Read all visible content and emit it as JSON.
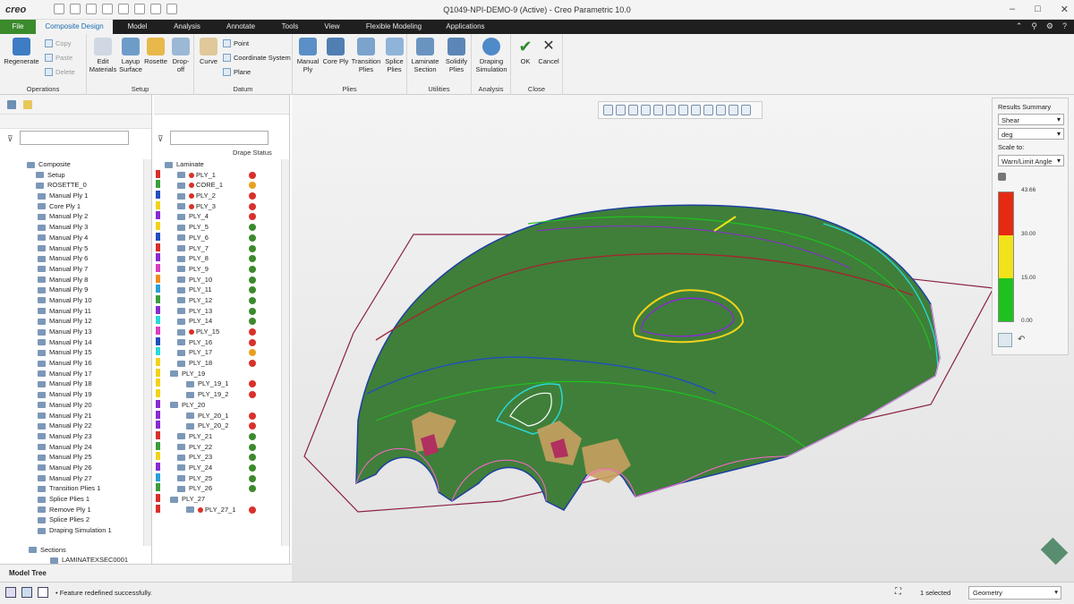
{
  "title_bar": {
    "logo": "creo",
    "window_title": "Q1049-NPI-DEMO-9 (Active) - Creo Parametric 10.0"
  },
  "tabs": [
    "File",
    "Composite Design",
    "Model",
    "Analysis",
    "Annotate",
    "Tools",
    "View",
    "Flexible Modeling",
    "Applications"
  ],
  "ribbon": {
    "operations": {
      "regenerate": "Regenerate",
      "copy": "Copy",
      "paste": "Paste",
      "delete": "Delete",
      "label": "Operations"
    },
    "setup": {
      "edit_materials": "Edit Materials",
      "layup_surface": "Layup Surface",
      "rosette": "Rosette",
      "drop_off": "Drop-off",
      "label": "Setup"
    },
    "datum": {
      "curve": "Curve",
      "point": "Point",
      "coordinate_system": "Coordinate System",
      "plane": "Plane",
      "label": "Datum"
    },
    "plies": {
      "manual_ply": "Manual Ply",
      "core_ply": "Core Ply",
      "transition_plies": "Transition Plies",
      "splice_plies": "Splice Plies",
      "label": "Plies"
    },
    "utilities": {
      "laminate_section": "Laminate Section",
      "solidify_plies": "Solidify Plies",
      "label": "Utilities"
    },
    "analysis": {
      "draping_simulation": "Draping Simulation",
      "label": "Analysis"
    },
    "close": {
      "ok": "OK",
      "cancel": "Cancel",
      "label": "Close"
    }
  },
  "model_tree": {
    "root": "Composite",
    "items": [
      "Setup",
      "ROSETTE_0",
      "Manual Ply 1",
      "Core Ply 1",
      "Manual Ply 2",
      "Manual Ply 3",
      "Manual Ply 4",
      "Manual Ply 5",
      "Manual Ply 6",
      "Manual Ply 7",
      "Manual Ply 8",
      "Manual Ply 9",
      "Manual Ply 10",
      "Manual Ply 11",
      "Manual Ply 12",
      "Manual Ply 13",
      "Manual Ply 14",
      "Manual Ply 15",
      "Manual Ply 16",
      "Manual Ply 17",
      "Manual Ply 18",
      "Manual Ply 19",
      "Manual Ply 20",
      "Manual Ply 21",
      "Manual Ply 22",
      "Manual Ply 23",
      "Manual Ply 24",
      "Manual Ply 25",
      "Manual Ply 26",
      "Manual Ply 27",
      "Transition Plies 1",
      "Splice Plies 1",
      "Remove Ply 1",
      "Splice Plies 2",
      "Draping Simulation 1"
    ],
    "sections": "Sections",
    "section_item": "LAMINATEXSEC0001",
    "bottom_tab": "Model Tree"
  },
  "laminate": {
    "header": "Drape Status",
    "root": "Laminate",
    "rows": [
      {
        "name": "PLY_1",
        "color": "#d9302a",
        "status": "r",
        "warn": true
      },
      {
        "name": "CORE_1",
        "color": "#3b9e3b",
        "status": "y",
        "warn": true
      },
      {
        "name": "PLY_2",
        "color": "#1f4fbf",
        "status": "r",
        "warn": true
      },
      {
        "name": "PLY_3",
        "color": "#f2d21a",
        "status": "r",
        "warn": true
      },
      {
        "name": "PLY_4",
        "color": "#8a2bd1",
        "status": "r",
        "warn": false
      },
      {
        "name": "PLY_5",
        "color": "#f2d21a",
        "status": "g",
        "warn": false
      },
      {
        "name": "PLY_6",
        "color": "#1f4fbf",
        "status": "g",
        "warn": false
      },
      {
        "name": "PLY_7",
        "color": "#d9302a",
        "status": "g",
        "warn": false
      },
      {
        "name": "PLY_8",
        "color": "#8a2bd1",
        "status": "g",
        "warn": false
      },
      {
        "name": "PLY_9",
        "color": "#d93fc4",
        "status": "g",
        "warn": false
      },
      {
        "name": "PLY_10",
        "color": "#f28a1a",
        "status": "g",
        "warn": false
      },
      {
        "name": "PLY_11",
        "color": "#2a9fd9",
        "status": "g",
        "warn": false
      },
      {
        "name": "PLY_12",
        "color": "#3b9e3b",
        "status": "g",
        "warn": false
      },
      {
        "name": "PLY_13",
        "color": "#8a2bd1",
        "status": "g",
        "warn": false
      },
      {
        "name": "PLY_14",
        "color": "#2ad9d9",
        "status": "g",
        "warn": false
      },
      {
        "name": "PLY_15",
        "color": "#d93fc4",
        "status": "r",
        "warn": true
      },
      {
        "name": "PLY_16",
        "color": "#1f4fbf",
        "status": "r",
        "warn": false
      },
      {
        "name": "PLY_17",
        "color": "#2ad9d9",
        "status": "y",
        "warn": false
      },
      {
        "name": "PLY_18",
        "color": "#f2d21a",
        "status": "r",
        "warn": false
      },
      {
        "name": "PLY_19",
        "color": "#f2d21a",
        "status": "",
        "warn": false,
        "group": true
      },
      {
        "name": "PLY_19_1",
        "color": "#f2d21a",
        "status": "r",
        "warn": false,
        "sub": true
      },
      {
        "name": "PLY_19_2",
        "color": "#f2d21a",
        "status": "r",
        "warn": false,
        "sub": true
      },
      {
        "name": "PLY_20",
        "color": "#8a2bd1",
        "status": "",
        "warn": false,
        "group": true
      },
      {
        "name": "PLY_20_1",
        "color": "#8a2bd1",
        "status": "r",
        "warn": false,
        "sub": true
      },
      {
        "name": "PLY_20_2",
        "color": "#8a2bd1",
        "status": "r",
        "warn": false,
        "sub": true
      },
      {
        "name": "PLY_21",
        "color": "#d9302a",
        "status": "g",
        "warn": false
      },
      {
        "name": "PLY_22",
        "color": "#3b9e3b",
        "status": "g",
        "warn": false
      },
      {
        "name": "PLY_23",
        "color": "#f2d21a",
        "status": "g",
        "warn": false
      },
      {
        "name": "PLY_24",
        "color": "#8a2bd1",
        "status": "g",
        "warn": false
      },
      {
        "name": "PLY_25",
        "color": "#2a9fd9",
        "status": "g",
        "warn": false
      },
      {
        "name": "PLY_26",
        "color": "#3b9e3b",
        "status": "g",
        "warn": false
      },
      {
        "name": "PLY_27",
        "color": "#d9302a",
        "status": "",
        "warn": false,
        "group": true
      },
      {
        "name": "PLY_27_1",
        "color": "#d9302a",
        "status": "r",
        "warn": true,
        "sub": true
      }
    ]
  },
  "results": {
    "title": "Results Summary",
    "type": "Shear",
    "unit": "deg",
    "scale_label": "Scale to:",
    "scale": "Warn/Limit Angle",
    "ticks": [
      "43.66",
      "30.00",
      "15.00",
      "0.00"
    ],
    "colors": {
      "red": "#e62a12",
      "yellow": "#f2e21a",
      "green": "#1ec21e"
    }
  },
  "status": {
    "message": "Feature redefined successfully.",
    "selected": "1 selected",
    "filter": "Geometry"
  }
}
